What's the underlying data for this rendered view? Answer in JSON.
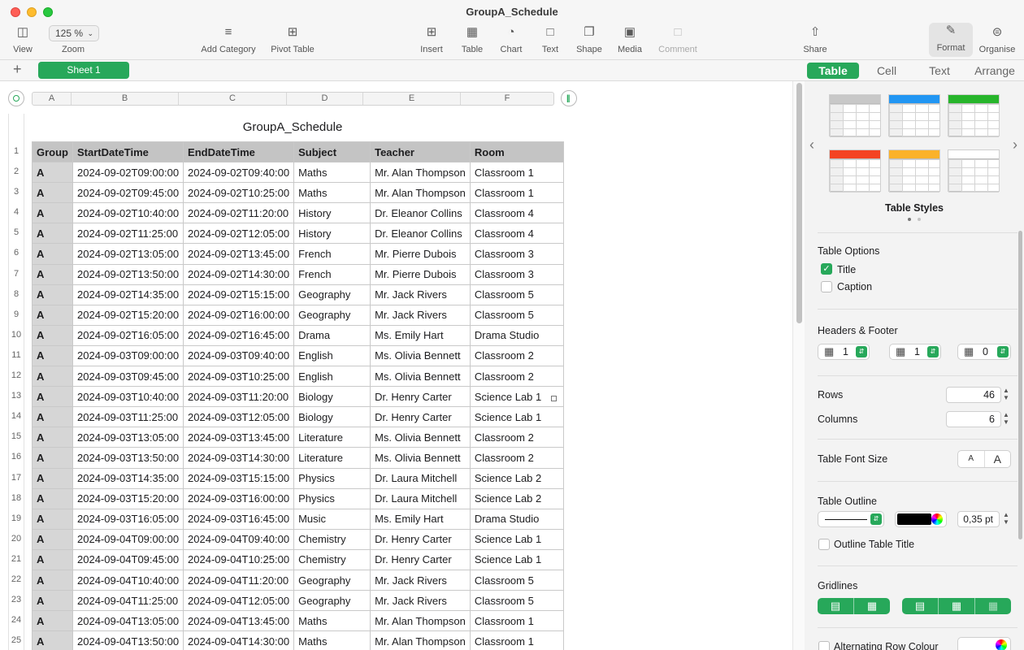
{
  "window": {
    "title": "GroupA_Schedule"
  },
  "toolbar": {
    "view": "View",
    "zoom_value": "125 %",
    "zoom": "Zoom",
    "add_category": "Add Category",
    "pivot_table": "Pivot Table",
    "insert": "Insert",
    "table": "Table",
    "chart": "Chart",
    "text": "Text",
    "shape": "Shape",
    "media": "Media",
    "comment": "Comment",
    "share": "Share",
    "format": "Format",
    "organise": "Organise"
  },
  "sheets": {
    "active": "Sheet 1"
  },
  "inspector_tabs": [
    "Table",
    "Cell",
    "Text",
    "Arrange"
  ],
  "sheet": {
    "table_title": "GroupA_Schedule",
    "column_letters": [
      "A",
      "B",
      "C",
      "D",
      "E",
      "F"
    ],
    "row_numbers": [
      "1",
      "2",
      "3",
      "4",
      "5",
      "6",
      "7",
      "8",
      "9",
      "10",
      "11",
      "12",
      "13",
      "14",
      "15",
      "16",
      "17",
      "18",
      "19",
      "20",
      "21",
      "22",
      "23",
      "24",
      "25"
    ],
    "headers": [
      "Group",
      "StartDateTime",
      "EndDateTime",
      "Subject",
      "Teacher",
      "Room"
    ],
    "rows": [
      [
        "A",
        "2024-09-02T09:00:00",
        "2024-09-02T09:40:00",
        "Maths",
        "Mr. Alan Thompson",
        "Classroom 1"
      ],
      [
        "A",
        "2024-09-02T09:45:00",
        "2024-09-02T10:25:00",
        "Maths",
        "Mr. Alan Thompson",
        "Classroom 1"
      ],
      [
        "A",
        "2024-09-02T10:40:00",
        "2024-09-02T11:20:00",
        "History",
        "Dr. Eleanor Collins",
        "Classroom 4"
      ],
      [
        "A",
        "2024-09-02T11:25:00",
        "2024-09-02T12:05:00",
        "History",
        "Dr. Eleanor Collins",
        "Classroom 4"
      ],
      [
        "A",
        "2024-09-02T13:05:00",
        "2024-09-02T13:45:00",
        "French",
        "Mr. Pierre Dubois",
        "Classroom 3"
      ],
      [
        "A",
        "2024-09-02T13:50:00",
        "2024-09-02T14:30:00",
        "French",
        "Mr. Pierre Dubois",
        "Classroom 3"
      ],
      [
        "A",
        "2024-09-02T14:35:00",
        "2024-09-02T15:15:00",
        "Geography",
        "Mr. Jack Rivers",
        "Classroom 5"
      ],
      [
        "A",
        "2024-09-02T15:20:00",
        "2024-09-02T16:00:00",
        "Geography",
        "Mr. Jack Rivers",
        "Classroom 5"
      ],
      [
        "A",
        "2024-09-02T16:05:00",
        "2024-09-02T16:45:00",
        "Drama",
        "Ms. Emily Hart",
        "Drama Studio"
      ],
      [
        "A",
        "2024-09-03T09:00:00",
        "2024-09-03T09:40:00",
        "English",
        "Ms. Olivia Bennett",
        "Classroom 2"
      ],
      [
        "A",
        "2024-09-03T09:45:00",
        "2024-09-03T10:25:00",
        "English",
        "Ms. Olivia Bennett",
        "Classroom 2"
      ],
      [
        "A",
        "2024-09-03T10:40:00",
        "2024-09-03T11:20:00",
        "Biology",
        "Dr. Henry Carter",
        "Science Lab 1"
      ],
      [
        "A",
        "2024-09-03T11:25:00",
        "2024-09-03T12:05:00",
        "Biology",
        "Dr. Henry Carter",
        "Science Lab 1"
      ],
      [
        "A",
        "2024-09-03T13:05:00",
        "2024-09-03T13:45:00",
        "Literature",
        "Ms. Olivia Bennett",
        "Classroom 2"
      ],
      [
        "A",
        "2024-09-03T13:50:00",
        "2024-09-03T14:30:00",
        "Literature",
        "Ms. Olivia Bennett",
        "Classroom 2"
      ],
      [
        "A",
        "2024-09-03T14:35:00",
        "2024-09-03T15:15:00",
        "Physics",
        "Dr. Laura Mitchell",
        "Science Lab 2"
      ],
      [
        "A",
        "2024-09-03T15:20:00",
        "2024-09-03T16:00:00",
        "Physics",
        "Dr. Laura Mitchell",
        "Science Lab 2"
      ],
      [
        "A",
        "2024-09-03T16:05:00",
        "2024-09-03T16:45:00",
        "Music",
        "Ms. Emily Hart",
        "Drama Studio"
      ],
      [
        "A",
        "2024-09-04T09:00:00",
        "2024-09-04T09:40:00",
        "Chemistry",
        "Dr. Henry Carter",
        "Science Lab 1"
      ],
      [
        "A",
        "2024-09-04T09:45:00",
        "2024-09-04T10:25:00",
        "Chemistry",
        "Dr. Henry Carter",
        "Science Lab 1"
      ],
      [
        "A",
        "2024-09-04T10:40:00",
        "2024-09-04T11:20:00",
        "Geography",
        "Mr. Jack Rivers",
        "Classroom 5"
      ],
      [
        "A",
        "2024-09-04T11:25:00",
        "2024-09-04T12:05:00",
        "Geography",
        "Mr. Jack Rivers",
        "Classroom 5"
      ],
      [
        "A",
        "2024-09-04T13:05:00",
        "2024-09-04T13:45:00",
        "Maths",
        "Mr. Alan Thompson",
        "Classroom 1"
      ],
      [
        "A",
        "2024-09-04T13:50:00",
        "2024-09-04T14:30:00",
        "Maths",
        "Mr. Alan Thompson",
        "Classroom 1"
      ]
    ]
  },
  "inspector": {
    "table_styles_label": "Table Styles",
    "style_header_colors": [
      "#c8c8c8",
      "#2196f3",
      "#27b52b",
      "#f44322",
      "#fbb22a",
      "#ffffff"
    ],
    "table_options": "Table Options",
    "title_option": "Title",
    "caption_option": "Caption",
    "headers_footer": "Headers & Footer",
    "header_rows": "1",
    "header_cols": "1",
    "footer_rows": "0",
    "rows_label": "Rows",
    "rows_value": "46",
    "columns_label": "Columns",
    "columns_value": "6",
    "font_size_label": "Table Font Size",
    "font_small": "A",
    "font_large": "A",
    "outline_label": "Table Outline",
    "outline_width": "0,35 pt",
    "outline_title": "Outline Table Title",
    "gridlines_label": "Gridlines",
    "alt_row_label": "Alternating Row Colour"
  },
  "colors": {
    "accent": "#27a85a",
    "header_fill": "#c4c4c4",
    "group_fill": "#d6d6d6"
  }
}
